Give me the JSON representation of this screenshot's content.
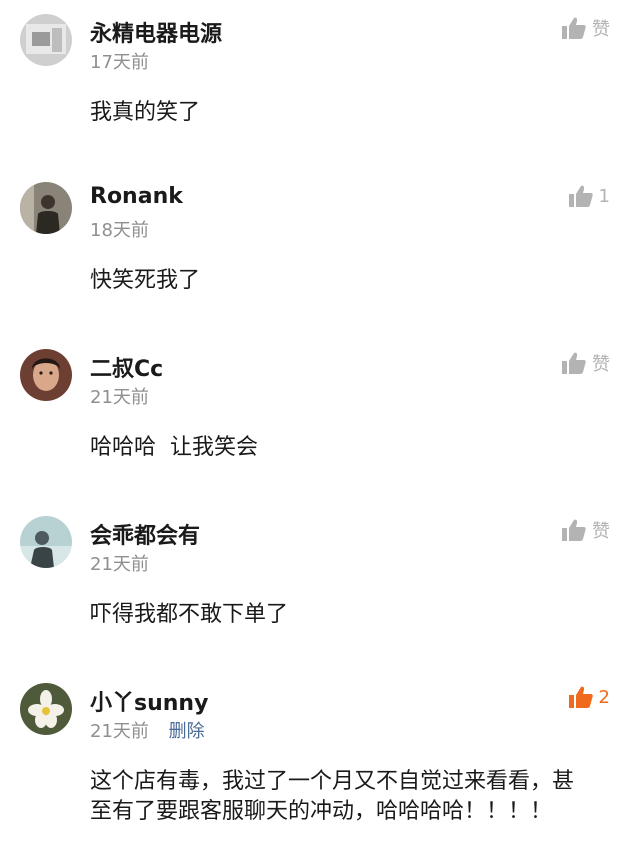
{
  "comments": [
    {
      "user": "永精电器电源",
      "time": "17天前",
      "text": "我真的笑了",
      "like_label": "赞",
      "liked": false
    },
    {
      "user": "Ronank",
      "time": "18天前",
      "text": "快笑死我了",
      "like_label": "1",
      "liked": false
    },
    {
      "user": "二叔Cc",
      "time": "21天前",
      "text": "哈哈哈  让我笑会",
      "like_label": "赞",
      "liked": false
    },
    {
      "user": "会乖都会有",
      "time": "21天前",
      "text": "吓得我都不敢下单了",
      "like_label": "赞",
      "liked": false
    },
    {
      "user": "小丫sunny",
      "time": "21天前",
      "delete_label": "删除",
      "text": "这个店有毒，我过了一个月又不自觉过来看看，甚至有了要跟客服聊天的冲动，哈哈哈哈！！！！",
      "like_label": "2",
      "liked": true
    }
  ],
  "colors": {
    "like_inactive": "#b3b3b3",
    "like_active": "#f06a1e",
    "meta": "#8f8f8f",
    "delete_link": "#4a6a96"
  },
  "icons": {
    "like": "thumbs-up-icon"
  }
}
